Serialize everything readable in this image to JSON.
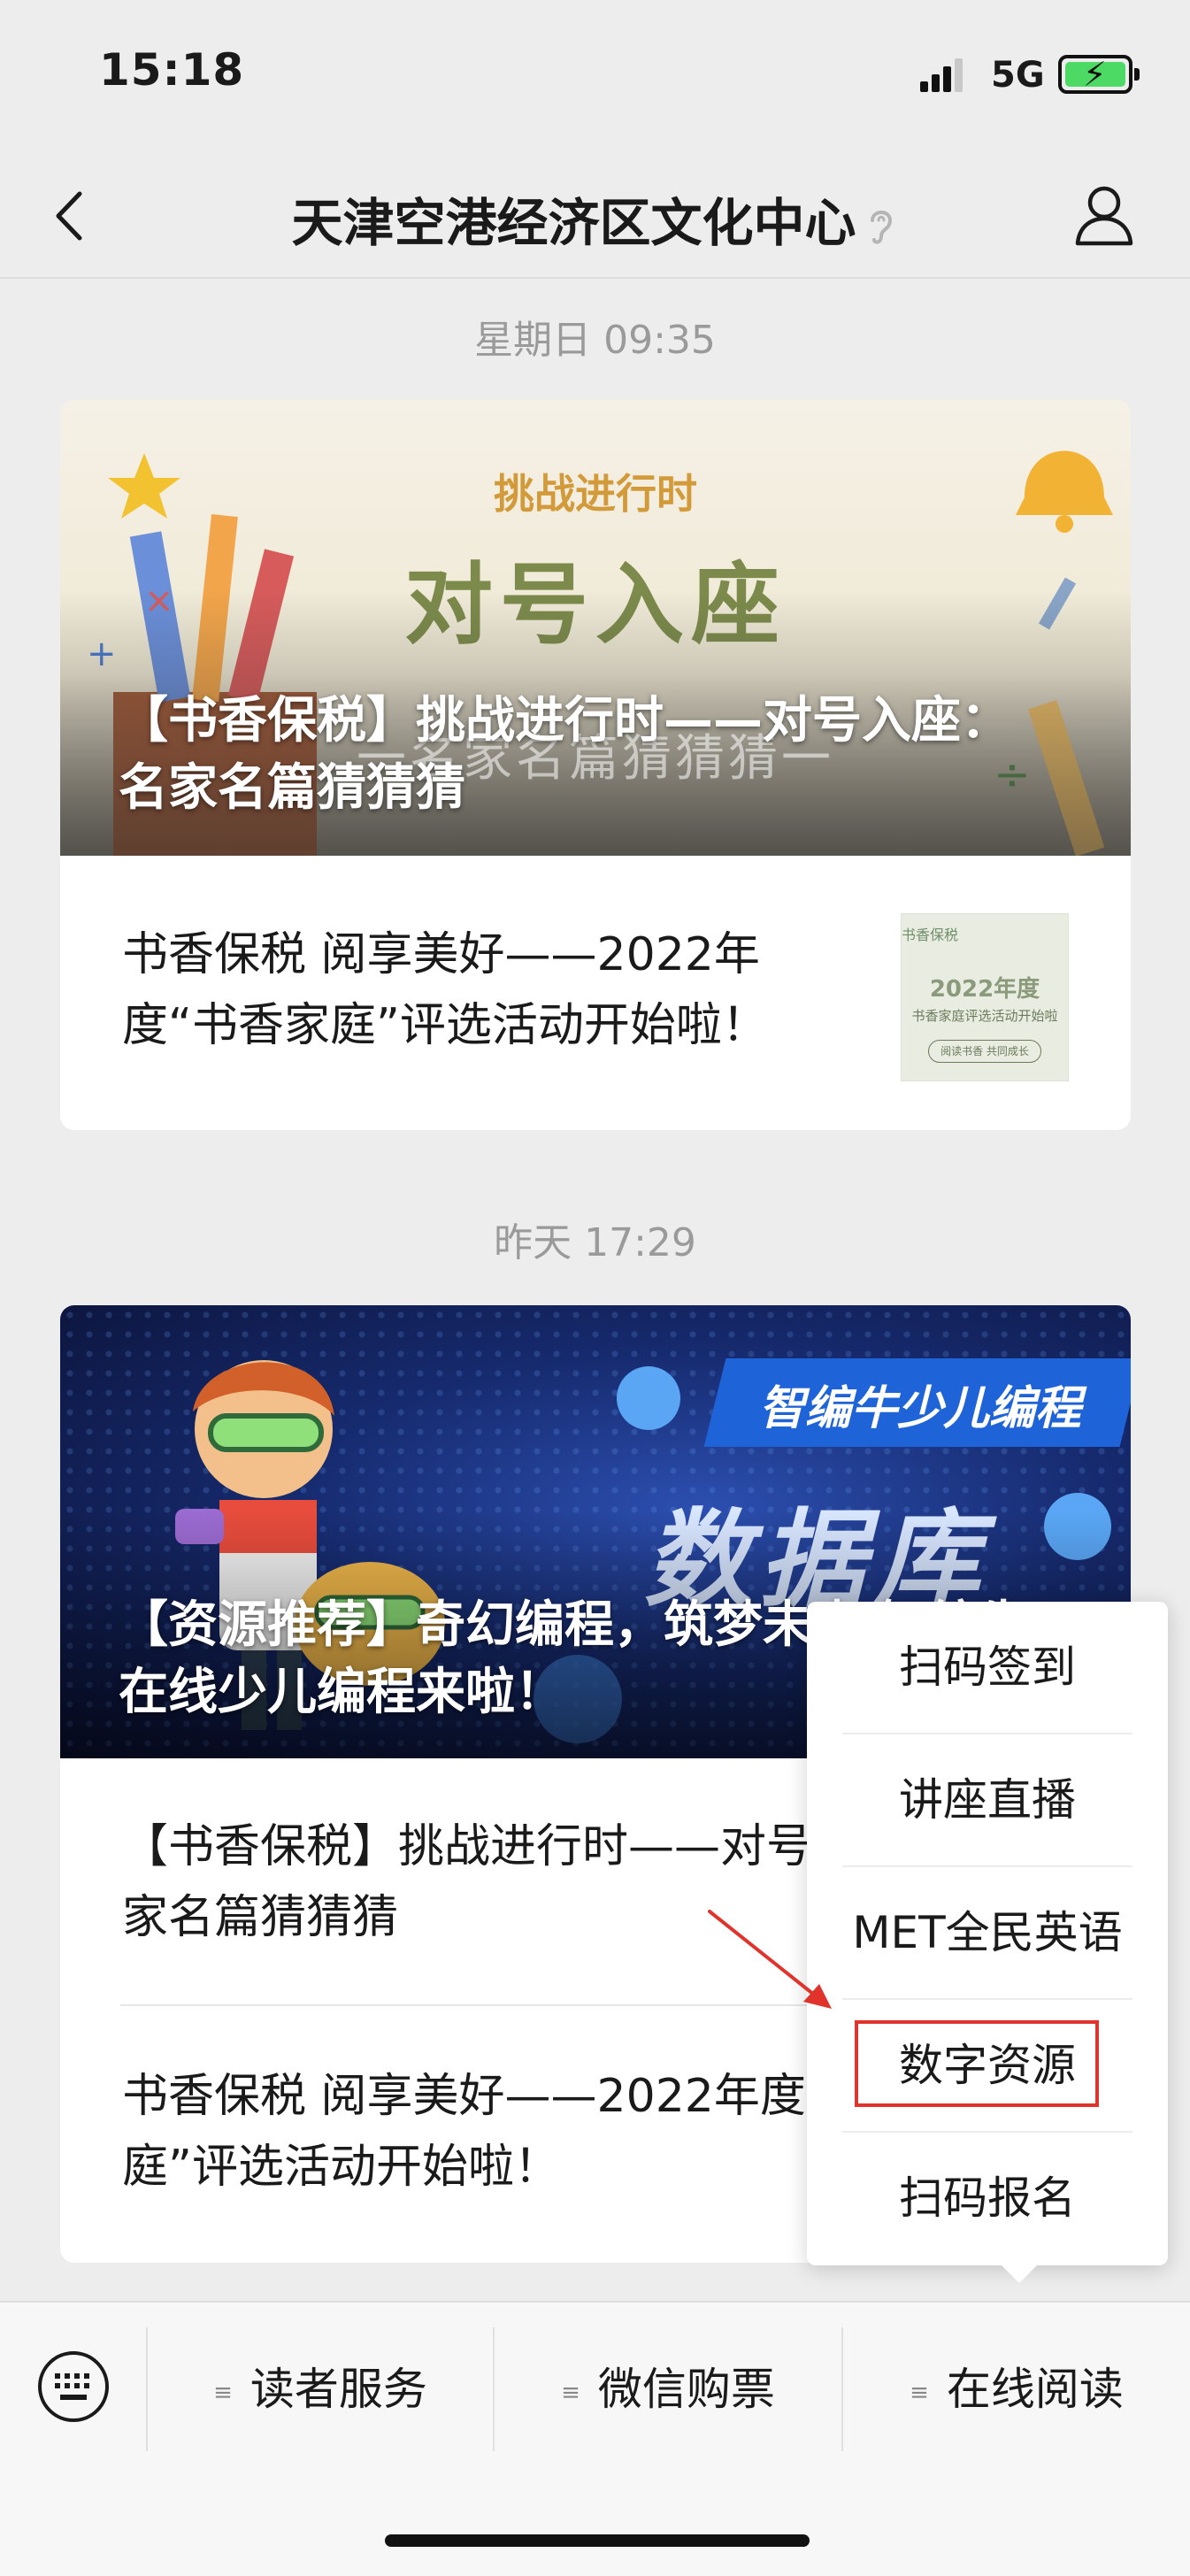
{
  "status_bar": {
    "time": "15:18",
    "network": "5G",
    "icons": [
      "signal-icon",
      "battery-charging-icon"
    ]
  },
  "nav": {
    "title": "天津空港经济区文化中心",
    "icons": [
      "back-icon",
      "ear-icon",
      "profile-icon"
    ]
  },
  "messages": [
    {
      "timestamp": "星期日 09:35",
      "cover": {
        "art_small": "挑战进行时",
        "art_big": "对号入座",
        "art_under": "一名家名篇猜猜猜一",
        "title": "【书香保税】挑战进行时——对号入座：名家名篇猜猜猜"
      },
      "items": [
        {
          "title": "书香保税 阅享美好——2022年度“书香家庭”评选活动开始啦！",
          "thumb": {
            "top": "书香保税",
            "year": "2022年度",
            "line": "书香家庭评选活动开始啦",
            "pill": "阅读书香 共同成长"
          }
        }
      ]
    },
    {
      "timestamp": "昨天 17:29",
      "cover": {
        "art_tag": "智编牛少儿编程",
        "art_big": "数据库",
        "title": "【资源推荐】奇幻编程，筑梦未来 智编牛在线少儿编程来啦！"
      },
      "items": [
        {
          "title": "【书香保税】挑战进行时——对号入座：名家名篇猜猜猜"
        },
        {
          "title": "书香保税 阅享美好——2022年度“书香家庭”评选活动开始啦！"
        }
      ]
    }
  ],
  "popup_menu": {
    "items": [
      "扫码签到",
      "讲座直播",
      "MET全民英语",
      "数字资源",
      "扫码报名"
    ],
    "highlighted": "数字资源",
    "highlight_color": "#e0332b"
  },
  "bottom_menu": {
    "items": [
      "读者服务",
      "微信购票",
      "在线阅读"
    ],
    "icons": [
      "keyboard-icon",
      "menu-icon"
    ]
  }
}
